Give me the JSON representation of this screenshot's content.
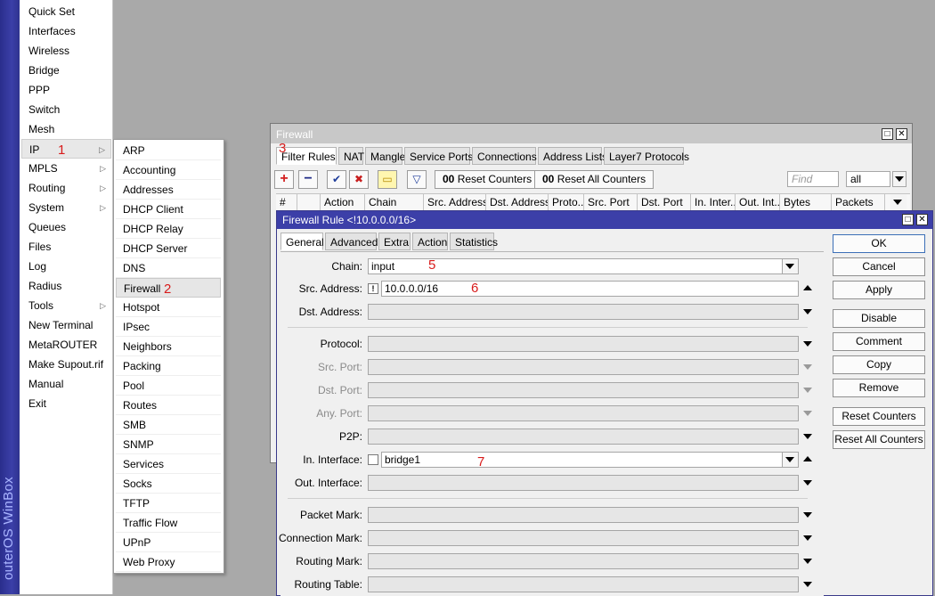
{
  "brand": {
    "text": "outerOS WinBox"
  },
  "main_menu": {
    "items": [
      {
        "label": "Quick Set",
        "arrow": false
      },
      {
        "label": "Interfaces",
        "arrow": false
      },
      {
        "label": "Wireless",
        "arrow": false
      },
      {
        "label": "Bridge",
        "arrow": false
      },
      {
        "label": "PPP",
        "arrow": false
      },
      {
        "label": "Switch",
        "arrow": false
      },
      {
        "label": "Mesh",
        "arrow": false
      },
      {
        "label": "IP",
        "arrow": true
      },
      {
        "label": "MPLS",
        "arrow": true
      },
      {
        "label": "Routing",
        "arrow": true
      },
      {
        "label": "System",
        "arrow": true
      },
      {
        "label": "Queues",
        "arrow": false
      },
      {
        "label": "Files",
        "arrow": false
      },
      {
        "label": "Log",
        "arrow": false
      },
      {
        "label": "Radius",
        "arrow": false
      },
      {
        "label": "Tools",
        "arrow": true
      },
      {
        "label": "New Terminal",
        "arrow": false
      },
      {
        "label": "MetaROUTER",
        "arrow": false
      },
      {
        "label": "Make Supout.rif",
        "arrow": false
      },
      {
        "label": "Manual",
        "arrow": false
      },
      {
        "label": "Exit",
        "arrow": false
      }
    ],
    "arrow_glyph": "▷"
  },
  "ip_submenu": {
    "items": [
      "ARP",
      "Accounting",
      "Addresses",
      "DHCP Client",
      "DHCP Relay",
      "DHCP Server",
      "DNS",
      "Firewall",
      "Hotspot",
      "IPsec",
      "Neighbors",
      "Packing",
      "Pool",
      "Routes",
      "SMB",
      "SNMP",
      "Services",
      "Socks",
      "TFTP",
      "Traffic Flow",
      "UPnP",
      "Web Proxy"
    ]
  },
  "annotations": {
    "n1": "1",
    "n2": "2",
    "n3": "3",
    "n5": "5",
    "n6": "6",
    "n7": "7"
  },
  "firewall_window": {
    "title": "Firewall",
    "tabs": [
      "Filter Rules",
      "NAT",
      "Mangle",
      "Service Ports",
      "Connections",
      "Address Lists",
      "Layer7 Protocols"
    ],
    "toolbar": {
      "add": "+",
      "remove": "−",
      "enable": "✔",
      "disable": "✖",
      "comment": "▭",
      "filter": "▽",
      "reset_counters": "Reset Counters",
      "reset_all_counters": "Reset All Counters",
      "counter_icon": "00",
      "find_placeholder": "Find",
      "scope_value": "all"
    },
    "columns": [
      "#",
      "",
      "Action",
      "Chain",
      "Src. Address",
      "Dst. Address",
      "Proto...",
      "Src. Port",
      "Dst. Port",
      "In. Inter...",
      "Out. Int...",
      "Bytes",
      "Packets"
    ]
  },
  "rule_window": {
    "title": "Firewall Rule <!10.0.0.0/16>",
    "tabs": [
      "General",
      "Advanced",
      "Extra",
      "Action",
      "Statistics"
    ],
    "fields": {
      "chain": {
        "label": "Chain:",
        "value": "input"
      },
      "src_address": {
        "label": "Src. Address:",
        "value": "10.0.0.0/16",
        "negate": "!"
      },
      "dst_address": {
        "label": "Dst. Address:",
        "value": ""
      },
      "protocol": {
        "label": "Protocol:",
        "value": ""
      },
      "src_port": {
        "label": "Src. Port:",
        "value": ""
      },
      "dst_port": {
        "label": "Dst. Port:",
        "value": ""
      },
      "any_port": {
        "label": "Any. Port:",
        "value": ""
      },
      "p2p": {
        "label": "P2P:",
        "value": ""
      },
      "in_interface": {
        "label": "In. Interface:",
        "value": "bridge1"
      },
      "out_interface": {
        "label": "Out. Interface:",
        "value": ""
      },
      "packet_mark": {
        "label": "Packet Mark:",
        "value": ""
      },
      "connection_mark": {
        "label": "Connection Mark:",
        "value": ""
      },
      "routing_mark": {
        "label": "Routing Mark:",
        "value": ""
      },
      "routing_table": {
        "label": "Routing Table:",
        "value": ""
      }
    },
    "buttons": {
      "ok": "OK",
      "cancel": "Cancel",
      "apply": "Apply",
      "disable": "Disable",
      "comment": "Comment",
      "copy": "Copy",
      "remove": "Remove",
      "reset_counters": "Reset Counters",
      "reset_all_counters": "Reset All Counters"
    }
  },
  "window_controls": {
    "restore": "□",
    "close": "✕"
  },
  "colors": {
    "titlebar_active": "#3c3fa8",
    "annotation_red": "#d81b1b",
    "brand_strip": "#2f338f"
  }
}
